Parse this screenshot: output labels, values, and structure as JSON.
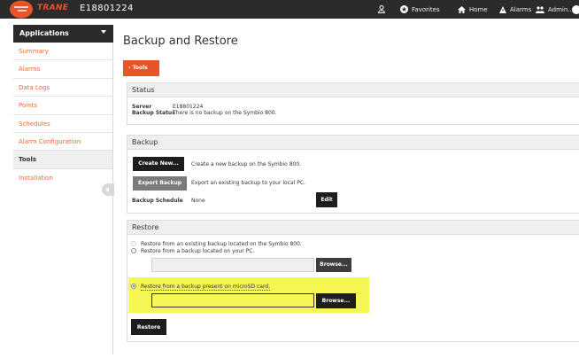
{
  "header": {
    "brand": "TRANE",
    "device_id": "E18801224",
    "nav": {
      "favorites": "Favorites",
      "home": "Home",
      "alarms": "Alarms",
      "admin": "Admin..."
    }
  },
  "sidebar": {
    "title": "Applications",
    "items": [
      {
        "label": "Summary"
      },
      {
        "label": "Alarms"
      },
      {
        "label": "Data Logs"
      },
      {
        "label": "Points"
      },
      {
        "label": "Schedules"
      },
      {
        "label": "Alarm Configuration"
      },
      {
        "label": "Tools"
      },
      {
        "label": "Installation"
      }
    ],
    "active": "Tools"
  },
  "page": {
    "title": "Backup and Restore",
    "tools_button": "Tools"
  },
  "status": {
    "heading": "Status",
    "server_label": "Server",
    "server_value": "E18801224",
    "backup_status_label": "Backup Status",
    "backup_status_value": "There is no backup on the Symbio 800."
  },
  "backup": {
    "heading": "Backup",
    "create_new_label": "Create New...",
    "create_new_desc": "Create a new backup on the Symbio 800.",
    "export_label": "Export Backup",
    "export_desc": "Export an existing backup to your local PC.",
    "schedule_label": "Backup Schedule",
    "schedule_value": "None",
    "edit_label": "Edit"
  },
  "restore": {
    "heading": "Restore",
    "option_existing": "Restore from an existing backup located on the Symbio 800.",
    "option_pc": "Restore from a backup located on your PC.",
    "option_microsd": "Restore from a backup present on microSD card.",
    "selected": "microsd",
    "pc_file_value": "",
    "microsd_file_value": "",
    "browse_label": "Browse...",
    "restore_label": "Restore"
  },
  "colors": {
    "accent": "#e8542a",
    "topbar": "#2b2b2b",
    "highlight": "#f5f553"
  }
}
